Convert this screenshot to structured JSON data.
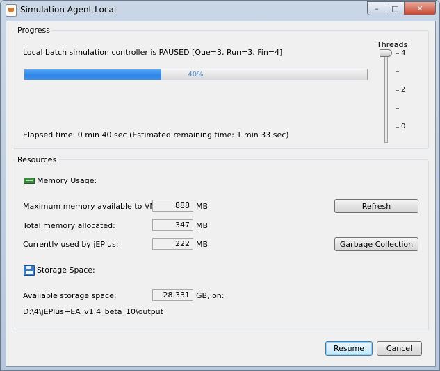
{
  "window": {
    "title": "Simulation Agent Local",
    "icon": "java-cup-icon"
  },
  "progress": {
    "legend": "Progress",
    "status": "Local batch simulation controller is PAUSED [Que=3, Run=3, Fin=4]",
    "percent": 40,
    "percent_label": "40%",
    "elapsed": "Elapsed time: 0 min 40 sec (Estimated remaining time: 1 min 33 sec)",
    "bar_color": "#3a8fe9"
  },
  "threads": {
    "label": "Threads",
    "value": 4,
    "labels": [
      "4",
      "2",
      "0"
    ]
  },
  "resources": {
    "legend": "Resources",
    "memory_heading": "Memory Usage:",
    "max_label": "Maximum memory available to VM:",
    "max_value": "888",
    "total_label": "Total memory allocated:",
    "total_value": "347",
    "used_label": "Currently used by jEPlus:",
    "used_value": "222",
    "unit_mb": "MB",
    "refresh_label": "Refresh",
    "gc_label": "Garbage Collection",
    "storage_heading": "Storage Space:",
    "avail_label": "Available storage space:",
    "avail_value": "28.331",
    "avail_unit": "GB, on:",
    "path": "D:\\4\\jEPlus+EA_v1.4_beta_10\\output"
  },
  "buttons": {
    "resume": "Resume",
    "cancel": "Cancel"
  }
}
